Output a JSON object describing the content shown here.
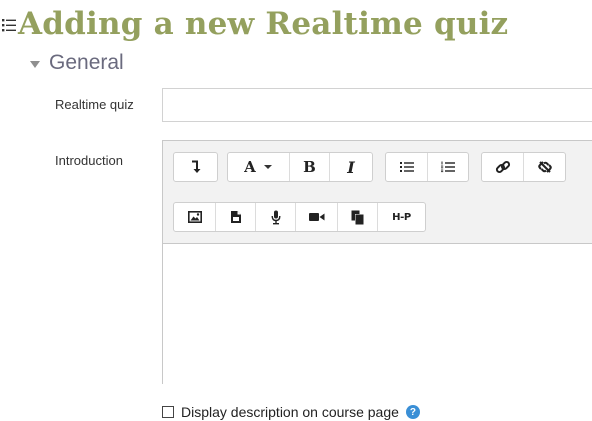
{
  "page": {
    "title": "Adding a new Realtime quiz"
  },
  "section": {
    "label": "General"
  },
  "fields": {
    "name_label": "Realtime quiz",
    "name_value": "",
    "intro_label": "Introduction",
    "intro_value": ""
  },
  "toolbar": {
    "row1": [
      {
        "name": "toolbar-toggle-button",
        "icon": "expand-toolbar-icon"
      },
      {
        "name": "font-color-button",
        "label": "A",
        "icon": "font-color-icon"
      },
      {
        "name": "bold-button",
        "label": "B",
        "icon": "bold-icon"
      },
      {
        "name": "italic-button",
        "label": "I",
        "icon": "italic-icon"
      },
      {
        "name": "unordered-list-button",
        "icon": "bullet-list-icon"
      },
      {
        "name": "ordered-list-button",
        "icon": "numbered-list-icon"
      },
      {
        "name": "link-button",
        "icon": "link-icon"
      },
      {
        "name": "unlink-button",
        "icon": "unlink-icon"
      }
    ],
    "row2": [
      {
        "name": "insert-image-button",
        "icon": "image-icon"
      },
      {
        "name": "insert-media-button",
        "icon": "file-icon"
      },
      {
        "name": "record-audio-button",
        "icon": "microphone-icon"
      },
      {
        "name": "record-video-button",
        "icon": "video-camera-icon"
      },
      {
        "name": "manage-files-button",
        "icon": "copy-files-icon"
      },
      {
        "name": "insert-h5p-button",
        "label": "H-P",
        "icon": "h5p-icon"
      }
    ]
  },
  "display_description": {
    "label": "Display description on course page",
    "checked": false,
    "help_icon": "question-circle-icon"
  },
  "colors": {
    "title": "#94a05e",
    "section": "#6a6a7e",
    "help": "#3a8fd6"
  }
}
